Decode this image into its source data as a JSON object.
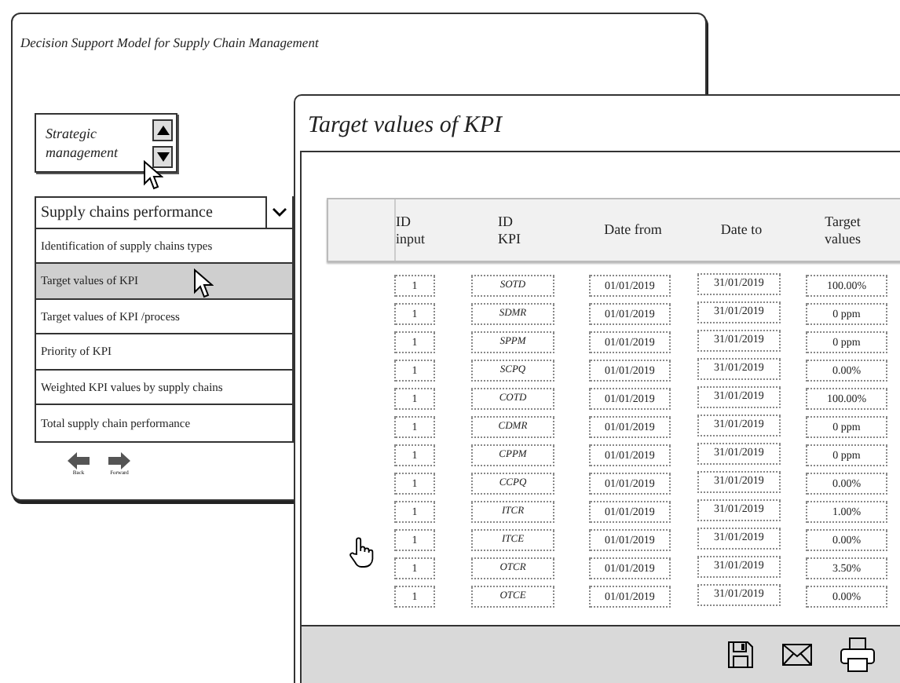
{
  "main_window": {
    "title": "Decision Support Model for Supply Chain Management",
    "spinner": {
      "text": "Strategic management"
    },
    "dropdown": {
      "value": "Supply chains performance"
    },
    "menu_items": [
      {
        "label": "Identification of supply chains types",
        "selected": false
      },
      {
        "label": "Target values of  KPI",
        "selected": true
      },
      {
        "label": "Target values of KPI /process",
        "selected": false
      },
      {
        "label": "Priority of KPI",
        "selected": false
      },
      {
        "label": "Weighted KPI values by supply chains",
        "selected": false
      },
      {
        "label": "Total supply chain performance",
        "selected": false
      }
    ],
    "nav": [
      {
        "kind": "back",
        "label": "Back"
      },
      {
        "kind": "forward",
        "label": "Forward"
      }
    ]
  },
  "kpi_window": {
    "title": "Target values of KPI",
    "columns": [
      "ID input",
      "ID KPI",
      "Date from",
      "Date to",
      "Target values"
    ],
    "rows": [
      {
        "id_input": "1",
        "id_kpi": "SOTD",
        "date_from": "01/01/2019",
        "date_to": "31/01/2019",
        "target": "100.00%"
      },
      {
        "id_input": "1",
        "id_kpi": "SDMR",
        "date_from": "01/01/2019",
        "date_to": "31/01/2019",
        "target": "0 ppm"
      },
      {
        "id_input": "1",
        "id_kpi": "SPPM",
        "date_from": "01/01/2019",
        "date_to": "31/01/2019",
        "target": "0 ppm"
      },
      {
        "id_input": "1",
        "id_kpi": "SCPQ",
        "date_from": "01/01/2019",
        "date_to": "31/01/2019",
        "target": "0.00%"
      },
      {
        "id_input": "1",
        "id_kpi": "COTD",
        "date_from": "01/01/2019",
        "date_to": "31/01/2019",
        "target": "100.00%"
      },
      {
        "id_input": "1",
        "id_kpi": "CDMR",
        "date_from": "01/01/2019",
        "date_to": "31/01/2019",
        "target": "0 ppm"
      },
      {
        "id_input": "1",
        "id_kpi": "CPPM",
        "date_from": "01/01/2019",
        "date_to": "31/01/2019",
        "target": "0 ppm"
      },
      {
        "id_input": "1",
        "id_kpi": "CCPQ",
        "date_from": "01/01/2019",
        "date_to": "31/01/2019",
        "target": "0.00%"
      },
      {
        "id_input": "1",
        "id_kpi": "ITCR",
        "date_from": "01/01/2019",
        "date_to": "31/01/2019",
        "target": "1.00%"
      },
      {
        "id_input": "1",
        "id_kpi": "ITCE",
        "date_from": "01/01/2019",
        "date_to": "31/01/2019",
        "target": "0.00%"
      },
      {
        "id_input": "1",
        "id_kpi": "OTCR",
        "date_from": "01/01/2019",
        "date_to": "31/01/2019",
        "target": "3.50%"
      },
      {
        "id_input": "1",
        "id_kpi": "OTCE",
        "date_from": "01/01/2019",
        "date_to": "31/01/2019",
        "target": "0.00%"
      }
    ]
  }
}
